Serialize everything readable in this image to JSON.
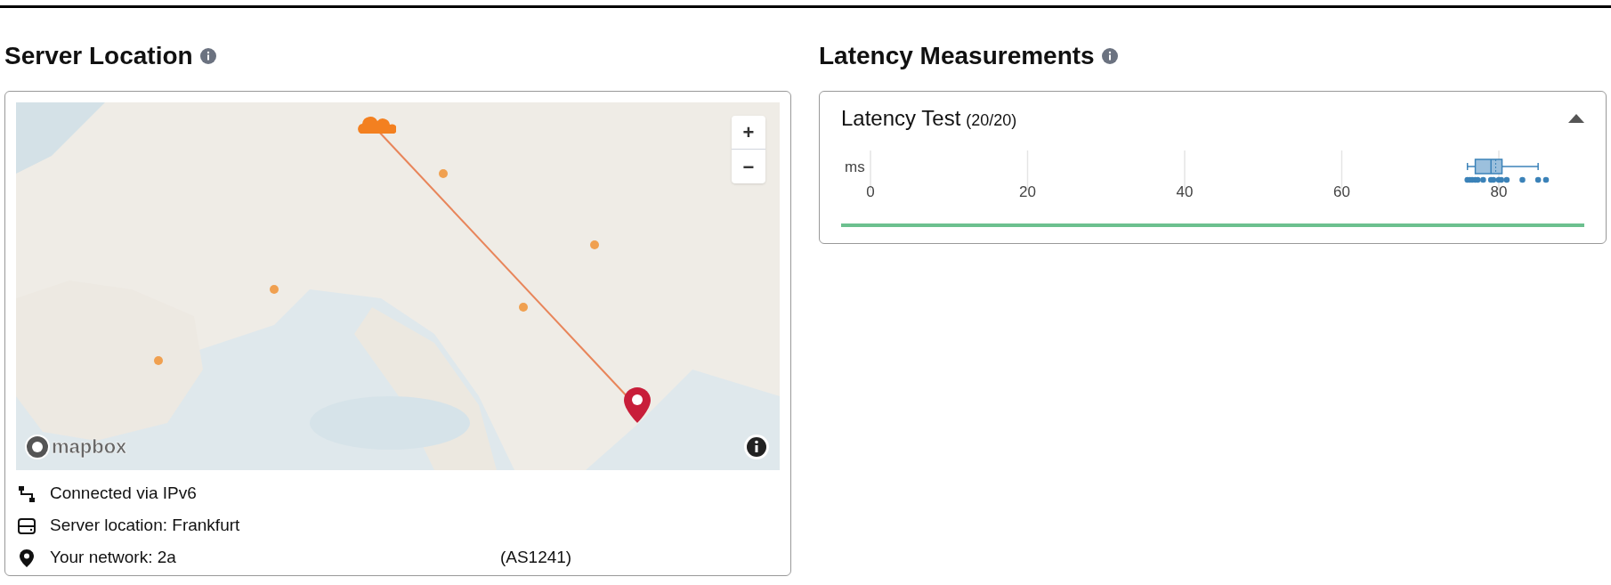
{
  "server_location": {
    "title": "Server Location",
    "map": {
      "zoom_in": "+",
      "zoom_out": "−",
      "logo": "mapbox"
    },
    "info": [
      {
        "kind": "connection",
        "text": "Connected via IPv6"
      },
      {
        "kind": "server",
        "text": "Server location: Frankfurt"
      },
      {
        "kind": "network",
        "text": "Your network: 2a",
        "text_end": "(AS1241)"
      }
    ]
  },
  "latency": {
    "title": "Latency Measurements",
    "panel": {
      "title": "Latency Test",
      "count": "(20/20)",
      "expanded": true,
      "axis": {
        "unit": "ms",
        "ticks": [
          "0",
          "20",
          "40",
          "60",
          "80"
        ]
      },
      "progress": {
        "level": 1
      }
    }
  }
}
